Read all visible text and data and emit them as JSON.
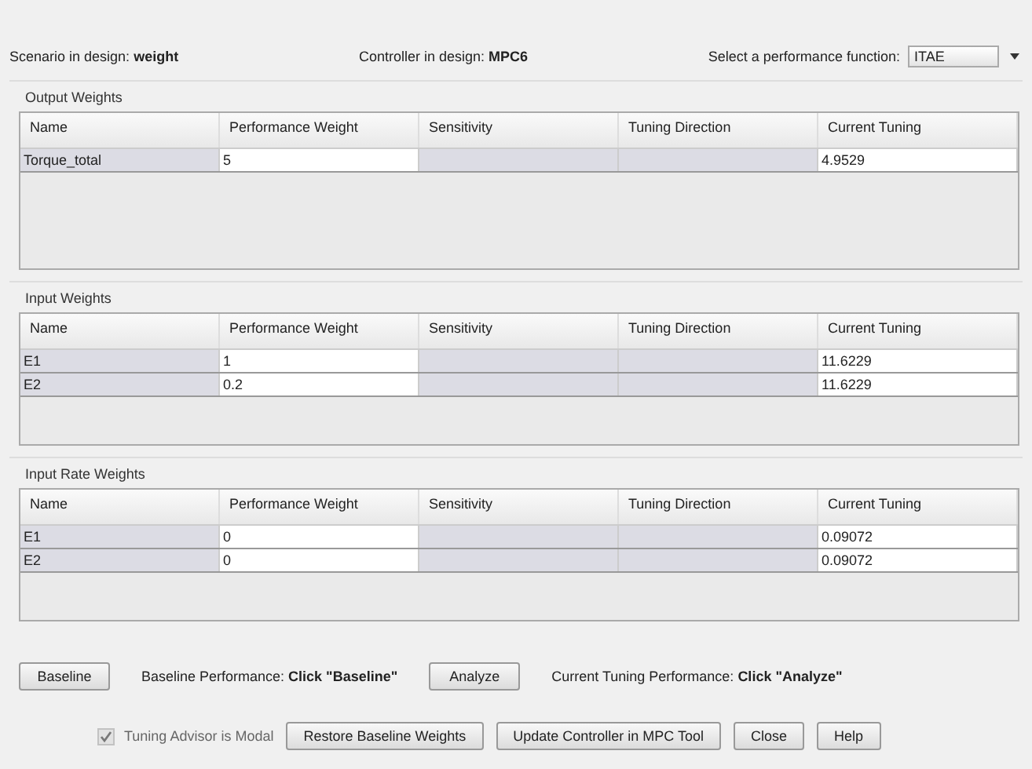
{
  "header": {
    "scenario": "Scenario in design: **weight**",
    "controller": "Controller in design: **MPC6**",
    "function_label": "Select a performance function:",
    "function_value": "ITAE"
  },
  "panels": [
    {
      "title": "Output Weights",
      "columns": [
        "Name",
        "Performance Weight",
        "Sensitivity",
        "Tuning Direction",
        "Current Tuning"
      ],
      "rows": [
        {
          "name": "Torque_total",
          "weight": "5",
          "current": "4.9529"
        }
      ]
    },
    {
      "title": "Input Weights",
      "columns": [
        "Name",
        "Performance Weight",
        "Sensitivity",
        "Tuning Direction",
        "Current Tuning"
      ],
      "rows": [
        {
          "name": "E1",
          "weight": "1",
          "current": "11.6229"
        },
        {
          "name": "E2",
          "weight": "0.2",
          "current": "11.6229"
        }
      ]
    },
    {
      "title": "Input Rate Weights",
      "columns": [
        "Name",
        "Performance Weight",
        "Sensitivity",
        "Tuning Direction",
        "Current Tuning"
      ],
      "rows": [
        {
          "name": "E1",
          "weight": "0",
          "current": "0.09072"
        },
        {
          "name": "E2",
          "weight": "0",
          "current": "0.09072"
        }
      ]
    }
  ],
  "performance": {
    "baseline_button": "Baseline",
    "baseline_text": "Baseline Performance: **Click \"Baseline\"**",
    "analyze_button": "Analyze",
    "current_text": "Current Tuning Performance: **Click \"Analyze\"**"
  },
  "footer": {
    "modal": {
      "label": "Tuning Advisor is Modal",
      "checked": true,
      "disabled": true
    },
    "buttons": [
      "Restore Baseline Weights",
      "Update Controller in MPC Tool",
      "Close",
      "Help"
    ]
  }
}
